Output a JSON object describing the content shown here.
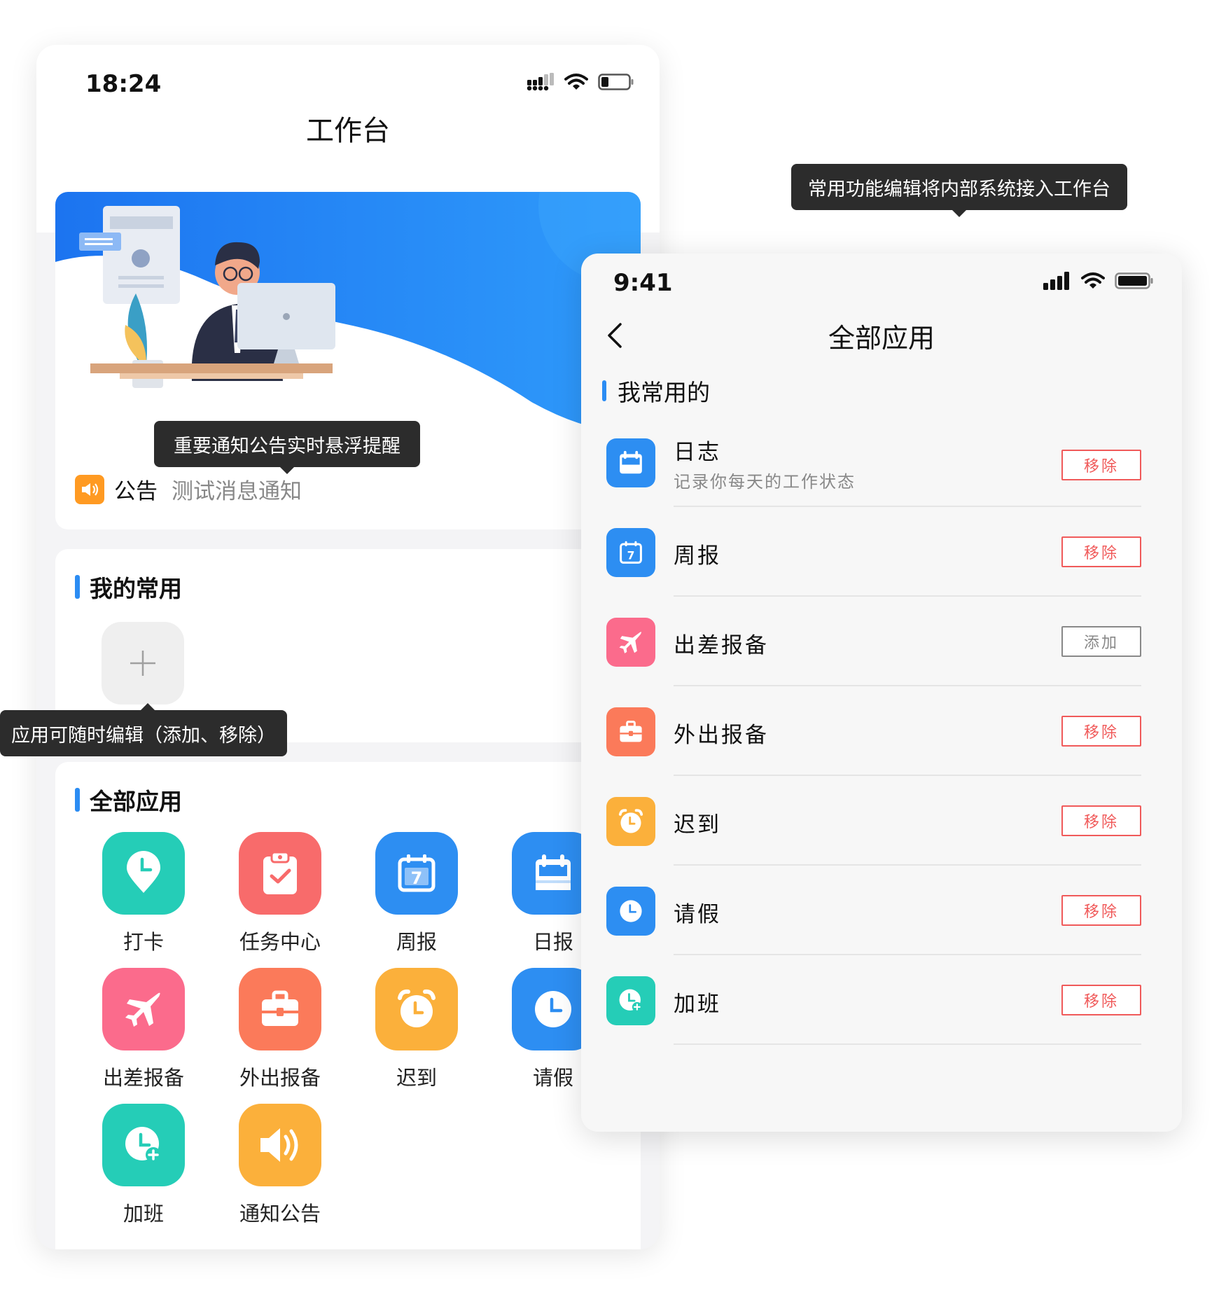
{
  "left_phone": {
    "time": "18:24",
    "title": "工作台",
    "notice": {
      "label": "公告",
      "text": "测试消息通知"
    },
    "tooltip_notice": "重要通知公告实时悬浮提醒",
    "fav_title": "我的常用",
    "tooltip_edit": "应用可随时编辑（添加、移除）",
    "all_title": "全部应用",
    "apps": [
      {
        "label": "打卡",
        "icon": "location-clock-icon",
        "color": "#25cdb7"
      },
      {
        "label": "任务中心",
        "icon": "clipboard-check-icon",
        "color": "#f86b6b"
      },
      {
        "label": "周报",
        "icon": "calendar-7-icon",
        "color": "#2d8ef2"
      },
      {
        "label": "日报",
        "icon": "calendar-icon",
        "color": "#2d8ef2"
      },
      {
        "label": "出差报备",
        "icon": "airplane-icon",
        "color": "#fb6b8c"
      },
      {
        "label": "外出报备",
        "icon": "briefcase-icon",
        "color": "#fb7a5a"
      },
      {
        "label": "迟到",
        "icon": "alarm-clock-icon",
        "color": "#fbb03b"
      },
      {
        "label": "请假",
        "icon": "clock-icon",
        "color": "#2d8ef2"
      },
      {
        "label": "加班",
        "icon": "clock-plus-icon",
        "color": "#25cdb7"
      },
      {
        "label": "通知公告",
        "icon": "speaker-icon",
        "color": "#fbb03b"
      }
    ]
  },
  "tooltip_right": "常用功能编辑将内部系统接入工作台",
  "right_phone": {
    "time": "9:41",
    "title": "全部应用",
    "section": "我常用的",
    "rows": [
      {
        "title": "日志",
        "subtitle": "记录你每天的工作状态",
        "action": "移除",
        "icon": "calendar-icon",
        "color": "#2d8ef2"
      },
      {
        "title": "周报",
        "subtitle": "",
        "action": "移除",
        "icon": "calendar-7-icon",
        "color": "#2d8ef2"
      },
      {
        "title": "出差报备",
        "subtitle": "",
        "action": "添加",
        "icon": "airplane-icon",
        "color": "#fb6b8c"
      },
      {
        "title": "外出报备",
        "subtitle": "",
        "action": "移除",
        "icon": "briefcase-icon",
        "color": "#fb7a5a"
      },
      {
        "title": "迟到",
        "subtitle": "",
        "action": "移除",
        "icon": "alarm-clock-icon",
        "color": "#fbb03b"
      },
      {
        "title": "请假",
        "subtitle": "",
        "action": "移除",
        "icon": "clock-icon",
        "color": "#2d8ef2"
      },
      {
        "title": "加班",
        "subtitle": "",
        "action": "移除",
        "icon": "clock-plus-icon",
        "color": "#25cdb7"
      }
    ]
  }
}
